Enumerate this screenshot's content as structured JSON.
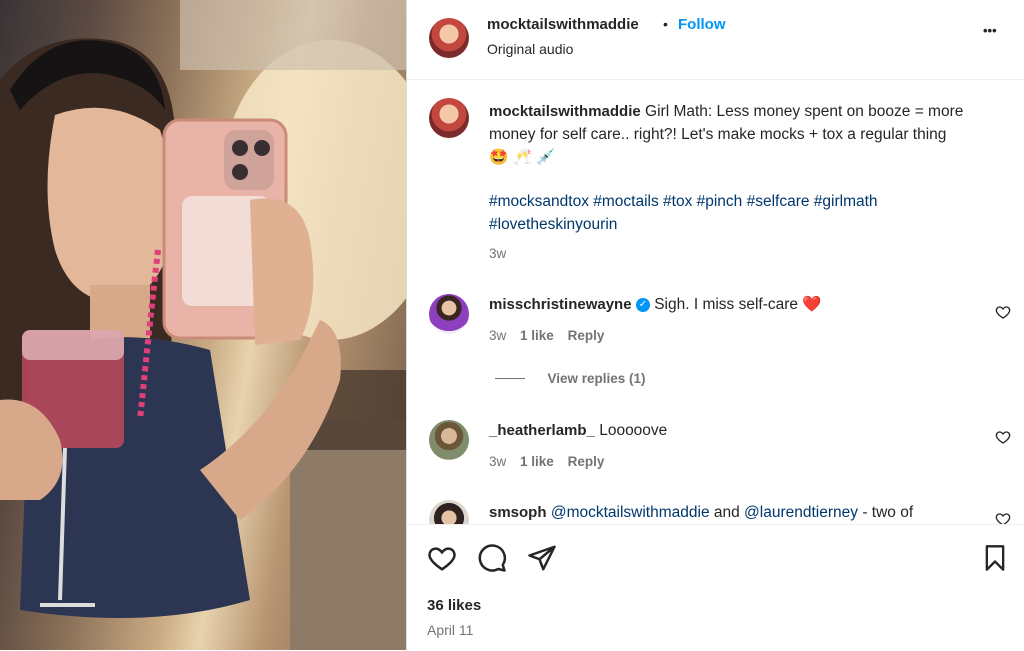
{
  "post": {
    "author": "mocktailswithmaddie",
    "separator": "•",
    "follow_label": "Follow",
    "subtitle": "Original audio",
    "more_label": "•••"
  },
  "caption": {
    "author": "mocktailswithmaddie",
    "text": "Girl Math: Less money spent on booze = more money for self care.. right?! Let's make mocks + tox a regular thing 🤩 🥂 💉",
    "hashtags": "#mocksandtox #moctails #tox #pinch #selfcare #girlmath #lovetheskinyourin",
    "time": "3w"
  },
  "comments": [
    {
      "user": "misschristinewayne",
      "verified": true,
      "text": "Sigh. I miss self-care ❤️",
      "time": "3w",
      "likes": "1 like",
      "reply_label": "Reply",
      "view_replies": "View replies (1)"
    },
    {
      "user": "_heatherlamb_",
      "text": "Looooove",
      "time": "3w",
      "likes": "1 like",
      "reply_label": "Reply"
    },
    {
      "user": "smsoph",
      "mention1": "@mocktailswithmaddie",
      "text_mid": " and ",
      "mention2": "@laurendtierney",
      "text_end": " - two of"
    }
  ],
  "stats": {
    "likes": "36 likes",
    "date": "April 11"
  },
  "icons": {
    "like": "heart-icon",
    "comment": "comment-icon",
    "share": "paper-plane-icon",
    "save": "bookmark-icon",
    "more": "more-icon",
    "verified": "verified-badge-icon"
  },
  "colors": {
    "follow": "#0095f6",
    "hashtag": "#00376b",
    "verified": "#0095f6",
    "muted": "#737373"
  }
}
